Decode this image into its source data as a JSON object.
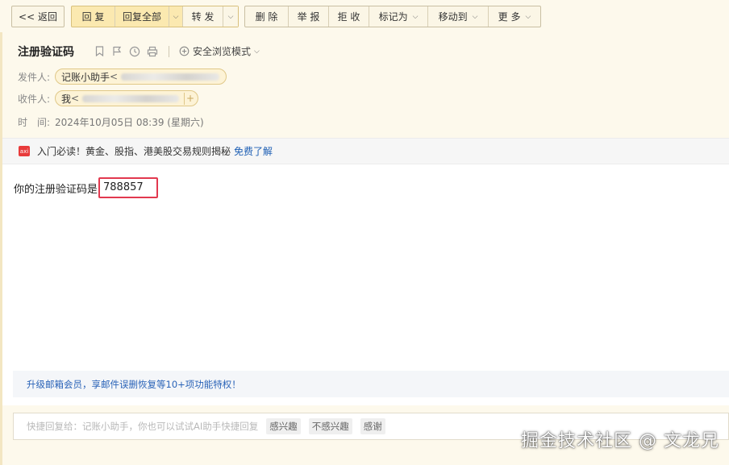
{
  "toolbar": {
    "back": "<< 返回",
    "reply": "回 复",
    "reply_all": "回复全部",
    "forward": "转 发",
    "delete": "删 除",
    "report": "举 报",
    "reject": "拒 收",
    "mark_as": "标记为",
    "move_to": "移动到",
    "more": "更 多"
  },
  "email": {
    "subject": "注册验证码",
    "safe_mode": "安全浏览模式",
    "from_label": "发件人:",
    "from_name": "记账小助手",
    "from_lt": "<",
    "to_label": "收件人:",
    "to_name": "我",
    "to_lt": "<",
    "time_label": "时　间:",
    "time_value": "2024年10月05日 08:39 (星期六)"
  },
  "promo": {
    "icon_text": "axi",
    "text": "入门必读！黄金、股指、港美股交易规则揭秘",
    "link": "免费了解"
  },
  "body": {
    "text": "你的注册验证码是",
    "code": "788857"
  },
  "vip": {
    "text": "升级邮箱会员，享邮件误删恢复等10+项功能特权！"
  },
  "quick_reply": {
    "placeholder": "快捷回复给：记账小助手，你也可以试试AI助手快捷回复",
    "chips": [
      "感兴趣",
      "不感兴趣",
      "感谢"
    ]
  },
  "watermark": "掘金技术社区 @ 文龙兄",
  "colors": {
    "header_bg": "#fdf9ec",
    "highlight_border": "#e2394f",
    "link": "#1e5fb4"
  }
}
